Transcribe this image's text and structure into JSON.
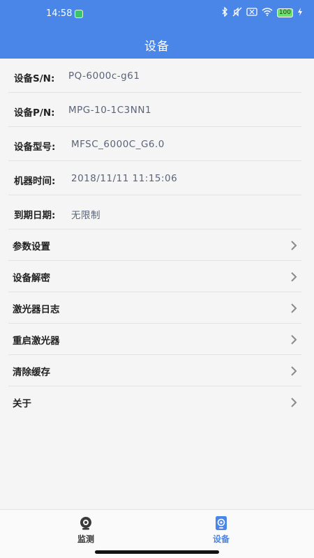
{
  "status_bar": {
    "time": "14:58",
    "battery": "100"
  },
  "header": {
    "title": "设备"
  },
  "info_rows": [
    {
      "label": "设备S/N:",
      "value": "PQ-6000c-g61"
    },
    {
      "label": "设备P/N:",
      "value": "MPG-10-1C3NN1"
    },
    {
      "label": "设备型号:",
      "value": "MFSC_6000C_G6.0"
    },
    {
      "label": "机器时间:",
      "value": "2018/11/11 11:15:06"
    },
    {
      "label": "到期日期:",
      "value": "无限制"
    }
  ],
  "menu_items": [
    {
      "label": "参数设置"
    },
    {
      "label": "设备解密"
    },
    {
      "label": "激光器日志"
    },
    {
      "label": "重启激光器"
    },
    {
      "label": "清除缓存"
    },
    {
      "label": "关于"
    }
  ],
  "tabs": [
    {
      "label": "监测",
      "icon": "camera-icon",
      "active": false
    },
    {
      "label": "设备",
      "icon": "device-icon",
      "active": true
    }
  ],
  "colors": {
    "accent": "#4a86e8",
    "value_text": "#5a6478",
    "divider": "#e2e2e2"
  }
}
